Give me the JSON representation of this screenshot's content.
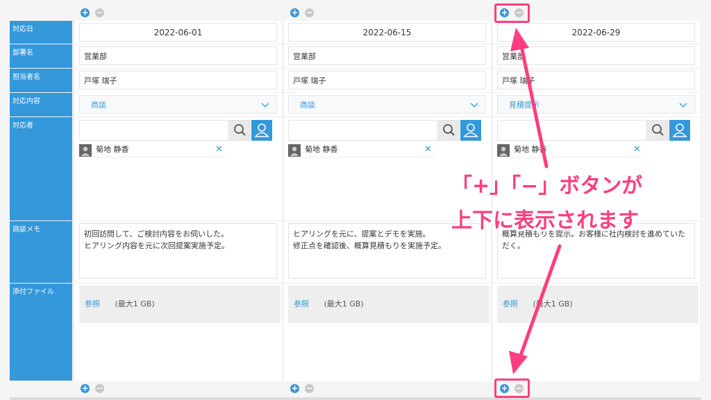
{
  "labels": {
    "date": "対応日",
    "dept": "部署名",
    "person": "担当者名",
    "content": "対応内容",
    "responder": "対応者",
    "memo": "商談メモ",
    "attachment": "添付ファイル"
  },
  "columns": [
    {
      "date": "2022-06-01",
      "dept": "営業部",
      "person": "戸塚 瑞子",
      "content": "商談",
      "responder": "菊地 静香",
      "memo": "初回訪問して、ご検討内容をお伺いした。\nヒアリング内容を元に次回提案実施予定。",
      "browse": "参照",
      "limit": "(最大1 GB)"
    },
    {
      "date": "2022-06-15",
      "dept": "営業部",
      "person": "戸塚 瑞子",
      "content": "商談",
      "responder": "菊地 静香",
      "memo": "ヒアリングを元に、提案とデモを実施。\n修正点を確認後、概算見積もりを実施予定。",
      "browse": "参照",
      "limit": "(最大1 GB)"
    },
    {
      "date": "2022-06-29",
      "dept": "営業部",
      "person": "戸塚 瑞子",
      "content": "見積提示",
      "responder": "菊地 静香",
      "memo": "概算見積もりを提示。お客様に社内検討を進めていただく。",
      "browse": "参照",
      "limit": "(最大1 GB)"
    }
  ],
  "actions": {
    "plus": "+",
    "minus": "−"
  },
  "icons": {
    "search": "search-icon",
    "user": "user-icon",
    "chevron": "chevron-down-icon",
    "remove": "close-icon"
  },
  "callout": {
    "line1": "「+」「−」ボタンが",
    "line2": "上下に表示されます"
  },
  "colors": {
    "accent": "#3498db",
    "highlight": "#ff3d7f",
    "minus": "#c8c8c8"
  }
}
